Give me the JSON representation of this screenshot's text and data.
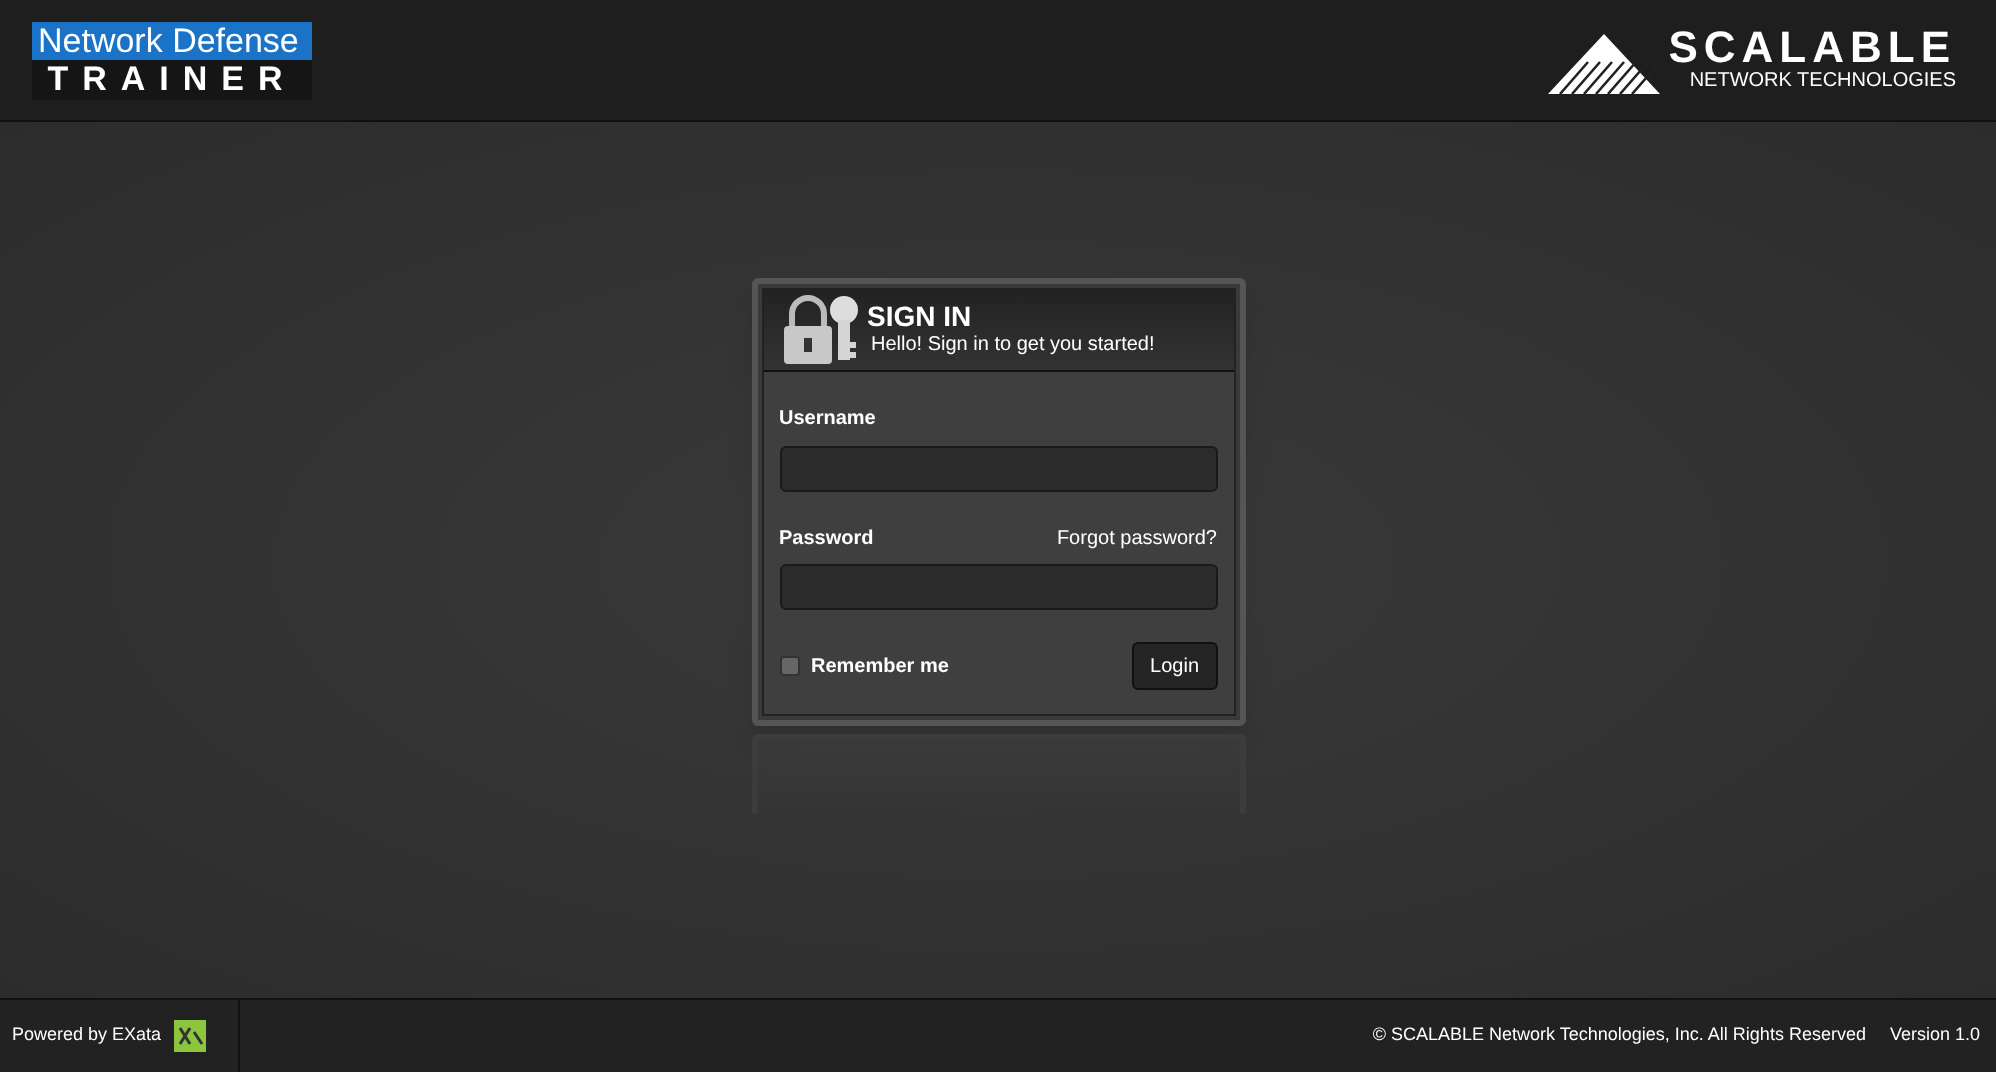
{
  "header": {
    "product_title": "Network Defense",
    "product_subtitle": "TRAINER",
    "company_name": "SCALABLE",
    "company_tagline": "NETWORK TECHNOLOGIES"
  },
  "sign_in": {
    "title": "SIGN IN",
    "subtitle": "Hello! Sign in to get you started!",
    "username": {
      "label": "Username"
    },
    "password": {
      "label": "Password",
      "forgot_link": "Forgot password?"
    },
    "remember": {
      "label": "Remember me",
      "checked": false
    },
    "login_button": "Login"
  },
  "footer": {
    "powered_by": "Powered by EXata",
    "copyright": "© SCALABLE Network Technologies, Inc. All Rights Reserved",
    "version": "Version 1.0"
  }
}
